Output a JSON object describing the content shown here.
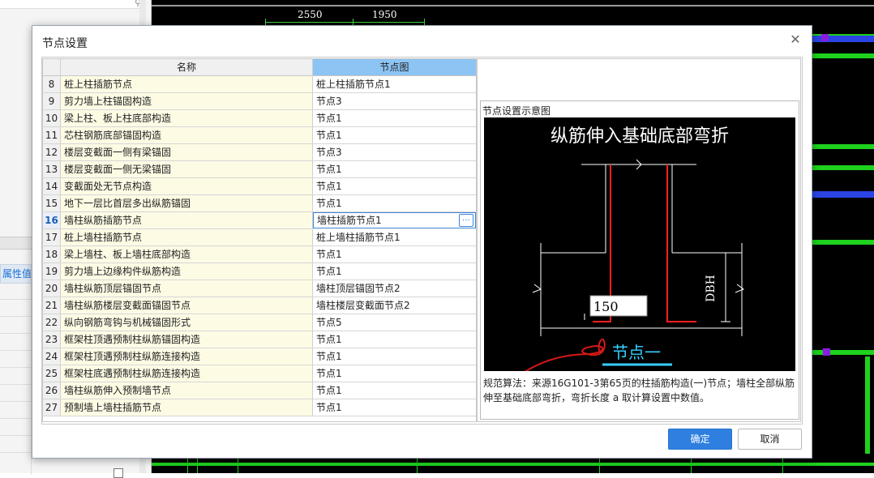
{
  "dialog": {
    "title": "节点设置",
    "close_icon": "close-icon",
    "ok_label": "确定",
    "cancel_label": "取消"
  },
  "table": {
    "headers": [
      "名称",
      "节点图"
    ],
    "selected_row": 16,
    "rows": [
      {
        "num": "8",
        "name": "桩上柱插筋节点",
        "value": "桩上柱插筋节点1"
      },
      {
        "num": "9",
        "name": "剪力墙上柱锚固构造",
        "value": "节点3"
      },
      {
        "num": "10",
        "name": "梁上柱、板上柱底部构造",
        "value": "节点1"
      },
      {
        "num": "11",
        "name": "芯柱钢筋底部锚固构造",
        "value": "节点1"
      },
      {
        "num": "12",
        "name": "楼层变截面一侧有梁锚固",
        "value": "节点3"
      },
      {
        "num": "13",
        "name": "楼层变截面一侧无梁锚固",
        "value": "节点1"
      },
      {
        "num": "14",
        "name": "变截面处无节点构造",
        "value": "节点1"
      },
      {
        "num": "15",
        "name": "地下一层比首层多出纵筋锚固",
        "value": "节点1"
      },
      {
        "num": "16",
        "name": "墙柱纵筋插筋节点",
        "value": "墙柱插筋节点1"
      },
      {
        "num": "17",
        "name": "桩上墙柱插筋节点",
        "value": "桩上墙柱插筋节点1"
      },
      {
        "num": "18",
        "name": "梁上墙柱、板上墙柱底部构造",
        "value": "节点1"
      },
      {
        "num": "19",
        "name": "剪力墙上边缘构件纵筋构造",
        "value": "节点1"
      },
      {
        "num": "20",
        "name": "墙柱纵筋顶层锚固节点",
        "value": "墙柱顶层锚固节点2"
      },
      {
        "num": "21",
        "name": "墙柱纵筋楼层变截面锚固节点",
        "value": "墙柱楼层变截面节点2"
      },
      {
        "num": "22",
        "name": "纵向钢筋弯钩与机械锚固形式",
        "value": "节点5"
      },
      {
        "num": "23",
        "name": "框架柱顶遇预制柱纵筋锚固构造",
        "value": "节点1"
      },
      {
        "num": "24",
        "name": "框架柱顶遇预制柱纵筋连接构造",
        "value": "节点1"
      },
      {
        "num": "25",
        "name": "框架柱底遇预制柱纵筋连接构造",
        "value": "节点1"
      },
      {
        "num": "26",
        "name": "墙柱纵筋伸入预制墙节点",
        "value": "节点1"
      },
      {
        "num": "27",
        "name": "预制墙上墙柱插筋节点",
        "value": "节点1"
      }
    ]
  },
  "preview": {
    "label": "节点设置示意图",
    "diagram_title": "纵筋伸入基础底部弯折",
    "dim_label": "DBH",
    "value_box": "150",
    "caption": "节点一",
    "description": "规范算法：来源16G101-3第65页的柱插筋构造(一)节点；墙柱全部纵筋伸至基础底部弯折，弯折长度 a 取计算设置中数值。"
  },
  "background": {
    "left_panel_attr_label": "属性值",
    "cad_dims": [
      "2550",
      "1950"
    ]
  },
  "colors": {
    "accent": "#2e7fe0",
    "header_selected": "#8cc4f4",
    "name_cell": "#fdfbe4",
    "rebar": "#ff2020",
    "caption": "#35d0ff"
  }
}
